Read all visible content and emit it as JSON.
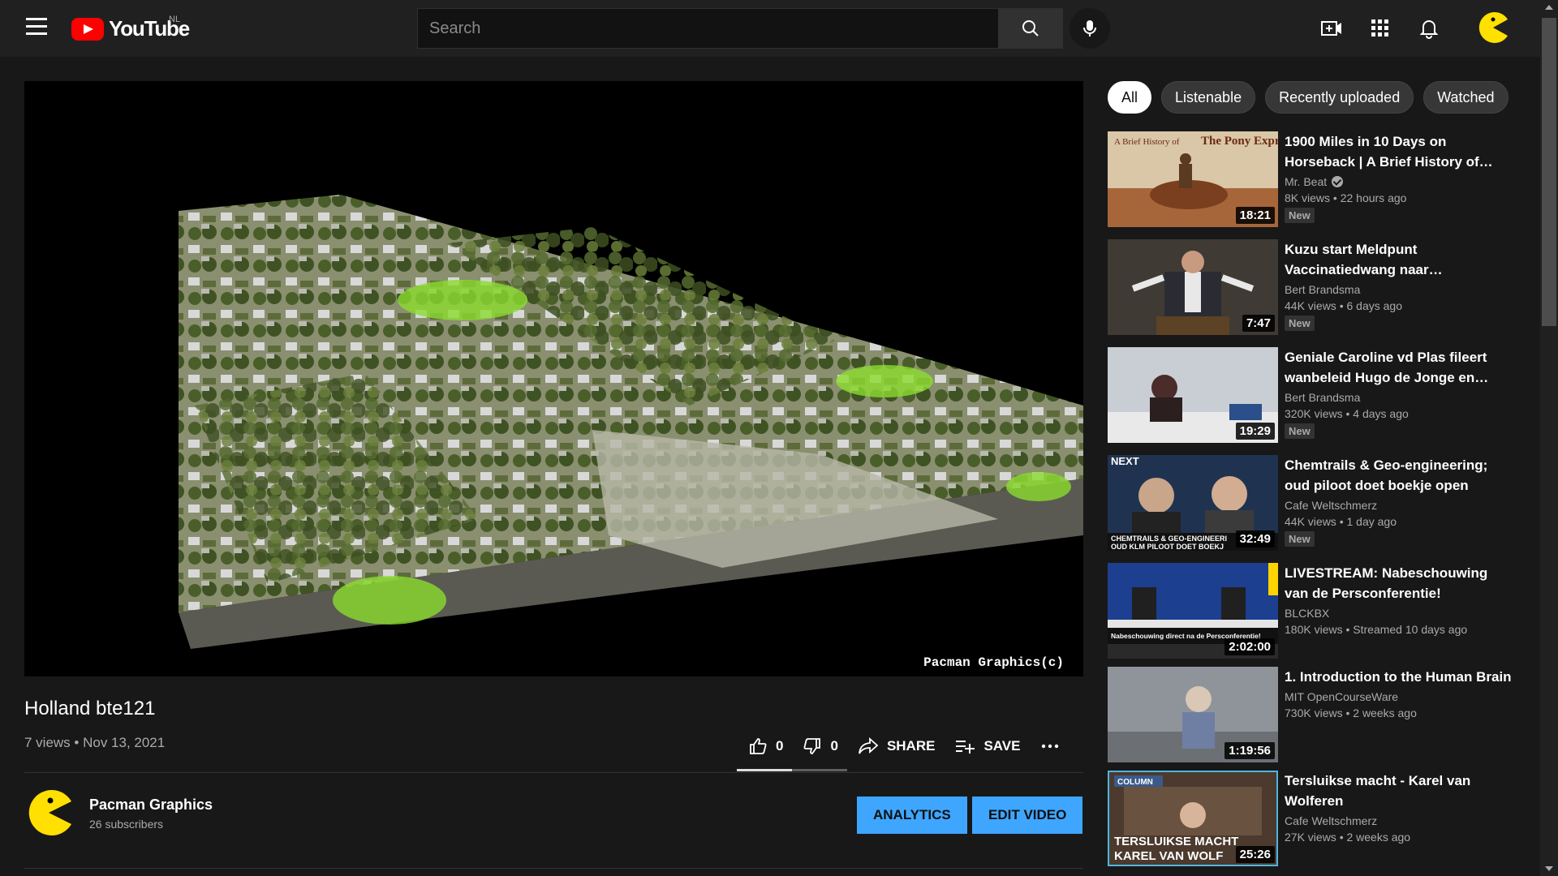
{
  "header": {
    "logo_text": "YouTube",
    "country_code": "NL",
    "search_placeholder": "Search"
  },
  "video": {
    "title": "Holland bte121",
    "meta": "7 views • Nov 13, 2021",
    "watermark": "Pacman Graphics(c)",
    "likes": "0",
    "dislikes": "0",
    "share_label": "SHARE",
    "save_label": "SAVE",
    "like_ratio": 0.5
  },
  "channel": {
    "name": "Pacman Graphics",
    "subscribers": "26 subscribers",
    "analytics_label": "ANALYTICS",
    "edit_label": "EDIT VIDEO"
  },
  "chips": [
    {
      "label": "All",
      "active": true
    },
    {
      "label": "Listenable",
      "active": false
    },
    {
      "label": "Recently uploaded",
      "active": false
    },
    {
      "label": "Watched",
      "active": false
    }
  ],
  "recommendations": [
    {
      "title": "1900 Miles in 10 Days on Horseback | A Brief History of…",
      "channel": "Mr. Beat",
      "verified": true,
      "stats": "8K views • 22 hours ago",
      "badge": "New",
      "duration": "18:21",
      "thumb_text_1": "A Brief History of",
      "thumb_text_2": "The Pony Express"
    },
    {
      "title": "Kuzu start Meldpunt Vaccinatiedwang naar…",
      "channel": "Bert Brandsma",
      "verified": false,
      "stats": "44K views • 6 days ago",
      "badge": "New",
      "duration": "7:47"
    },
    {
      "title": "Geniale Caroline vd Plas fileert wanbeleid Hugo de Jonge en…",
      "channel": "Bert Brandsma",
      "verified": false,
      "stats": "320K views • 4 days ago",
      "badge": "New",
      "duration": "19:29"
    },
    {
      "title": "Chemtrails & Geo-engineering; oud piloot doet boekje open",
      "channel": "Cafe Weltschmerz",
      "verified": false,
      "stats": "44K views • 1 day ago",
      "badge": "New",
      "duration": "32:49",
      "thumb_text_1": "NEXT",
      "thumb_text_2": "CHEMTRAILS & GEO-ENGINEERI",
      "thumb_text_3": "OUD KLM PILOOT DOET BOEKJ"
    },
    {
      "title": "LIVESTREAM: Nabeschouwing van de Persconferentie!",
      "channel": "BLCKBX",
      "verified": false,
      "stats": "180K views • Streamed 10 days ago",
      "badge": "",
      "duration": "2:02:00",
      "thumb_text_1": "Nabeschouwing direct na de Persconferentie!"
    },
    {
      "title": "1. Introduction to the Human Brain",
      "channel": "MIT OpenCourseWare",
      "verified": false,
      "stats": "730K views • 2 weeks ago",
      "badge": "",
      "duration": "1:19:56"
    },
    {
      "title": "Tersluikse macht - Karel van Wolferen",
      "channel": "Cafe Weltschmerz",
      "verified": false,
      "stats": "27K views • 2 weeks ago",
      "badge": "",
      "duration": "25:26",
      "thumb_text_1": "COLUMN",
      "thumb_text_2": "TERSLUIKSE MACHT",
      "thumb_text_3": "KAREL VAN WOLF"
    }
  ],
  "colors": {
    "accent_blue": "#3ea6ff",
    "youtube_red": "#ff0000",
    "pacman_yellow": "#ffe000"
  }
}
